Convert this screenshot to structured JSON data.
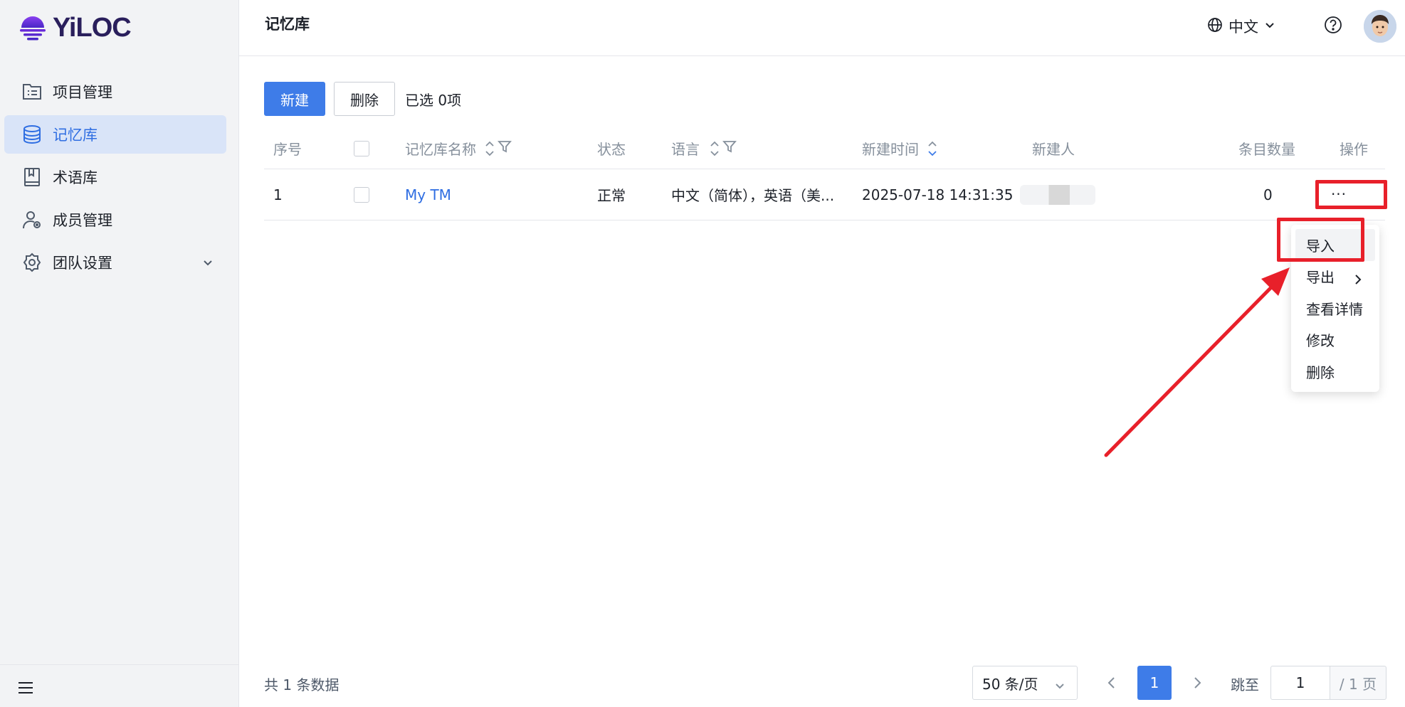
{
  "app": {
    "brand": "YiLOC",
    "brand_color": "#6a2bd9"
  },
  "sidebar": {
    "items": [
      {
        "label": "项目管理",
        "icon": "project-list-icon",
        "active": false
      },
      {
        "label": "记忆库",
        "icon": "database-icon",
        "active": true
      },
      {
        "label": "术语库",
        "icon": "book-icon",
        "active": false
      },
      {
        "label": "成员管理",
        "icon": "user-settings-icon",
        "active": false
      },
      {
        "label": "团队设置",
        "icon": "gear-icon",
        "active": false,
        "expandable": true
      }
    ],
    "bottom_icon": "hamburger-menu-icon"
  },
  "header": {
    "title": "记忆库",
    "language": "中文",
    "icons": [
      "globe-icon",
      "help-icon",
      "avatar"
    ]
  },
  "toolbar": {
    "new_label": "新建",
    "delete_label": "删除",
    "selected_text": "已选 0项"
  },
  "table": {
    "columns": [
      "序号",
      "",
      "记忆库名称",
      "状态",
      "语言",
      "新建时间",
      "新建人",
      "条目数量",
      "操作"
    ],
    "rows": [
      {
        "index": "1",
        "name": "My TM",
        "status": "正常",
        "language": "中文（简体），英语（美...",
        "created_at": "2025-07-18 14:31:35",
        "creator": "",
        "entries": "0",
        "action": "···"
      }
    ]
  },
  "dropdown": {
    "items": [
      "导入",
      "导出",
      "查看详情",
      "修改",
      "删除"
    ]
  },
  "footer": {
    "total": "共 1 条数据",
    "page_size": "50 条/页",
    "current_page": "1",
    "jump_label": "跳至",
    "jump_value": "1",
    "page_total": "/ 1 页"
  },
  "colors": {
    "primary": "#3e7ce8",
    "highlight_red": "#e8202a",
    "active_bg": "#d9e4f8"
  }
}
